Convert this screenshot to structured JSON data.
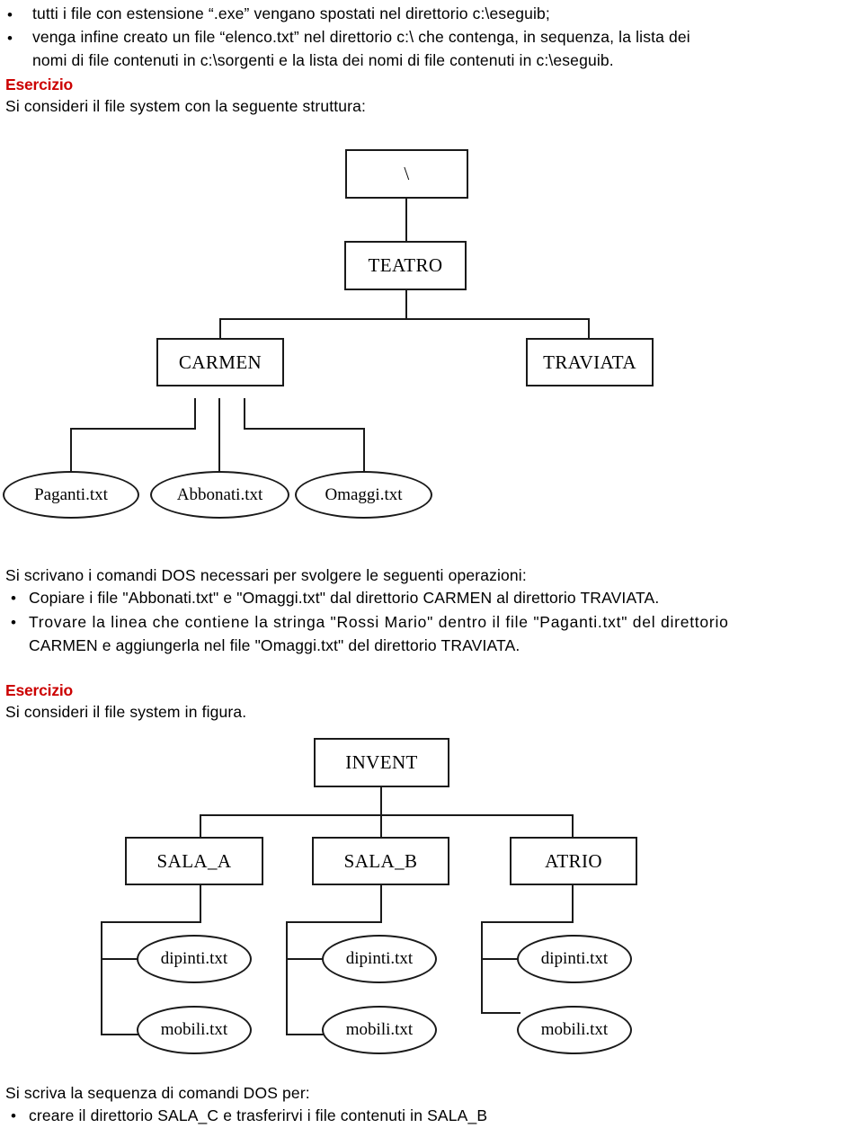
{
  "intro": {
    "bullet1": "tutti i file con estensione “.exe” vengano spostati nel direttorio c:\\eseguib;",
    "bullet2_line1": "venga infine creato un file “elenco.txt” nel direttorio c:\\ che contenga, in sequenza, la lista dei",
    "bullet2_line2": "nomi di file contenuti in c:\\sorgenti e la lista dei nomi di file contenuti in c:\\eseguib.",
    "bullet_glyph": "•"
  },
  "exercise1": {
    "heading": "Esercizio",
    "heading_color": "#CC0000",
    "intro": "Si consideri il file system con la seguente struttura:"
  },
  "tree1": {
    "root": "\\",
    "level1": "TEATRO",
    "level2": [
      "CARMEN",
      "TRAVIATA"
    ],
    "files": [
      "Paganti.txt",
      "Abbonati.txt",
      "Omaggi.txt"
    ]
  },
  "tasks1": {
    "intro": "Si scrivano i comandi DOS necessari per svolgere le seguenti operazioni:",
    "items": [
      {
        "line1": "Copiare i file \"Abbonati.txt\" e \"Omaggi.txt\" dal direttorio CARMEN al direttorio TRAVIATA.",
        "line2": ""
      },
      {
        "line1": "Trovare la linea che contiene la stringa \"Rossi Mario\" dentro il file \"Paganti.txt\" del direttorio",
        "line2": "CARMEN e aggiungerla nel file \"Omaggi.txt\" del direttorio TRAVIATA."
      }
    ]
  },
  "exercise2": {
    "heading": "Esercizio",
    "heading_color": "#CC0000",
    "intro": "Si consideri il file system in figura."
  },
  "tree2": {
    "root": "INVENT",
    "level1": [
      "SALA_A",
      "SALA_B",
      "ATRIO"
    ],
    "files": [
      [
        "dipinti.txt",
        "mobili.txt"
      ],
      [
        "dipinti.txt",
        "mobili.txt"
      ],
      [
        "dipinti.txt",
        "mobili.txt"
      ]
    ]
  },
  "tasks2": {
    "intro": "Si scriva la sequenza di comandi DOS per:",
    "items": [
      "creare il direttorio SALA_C e trasferirvi i file contenuti in SALA_B"
    ]
  }
}
